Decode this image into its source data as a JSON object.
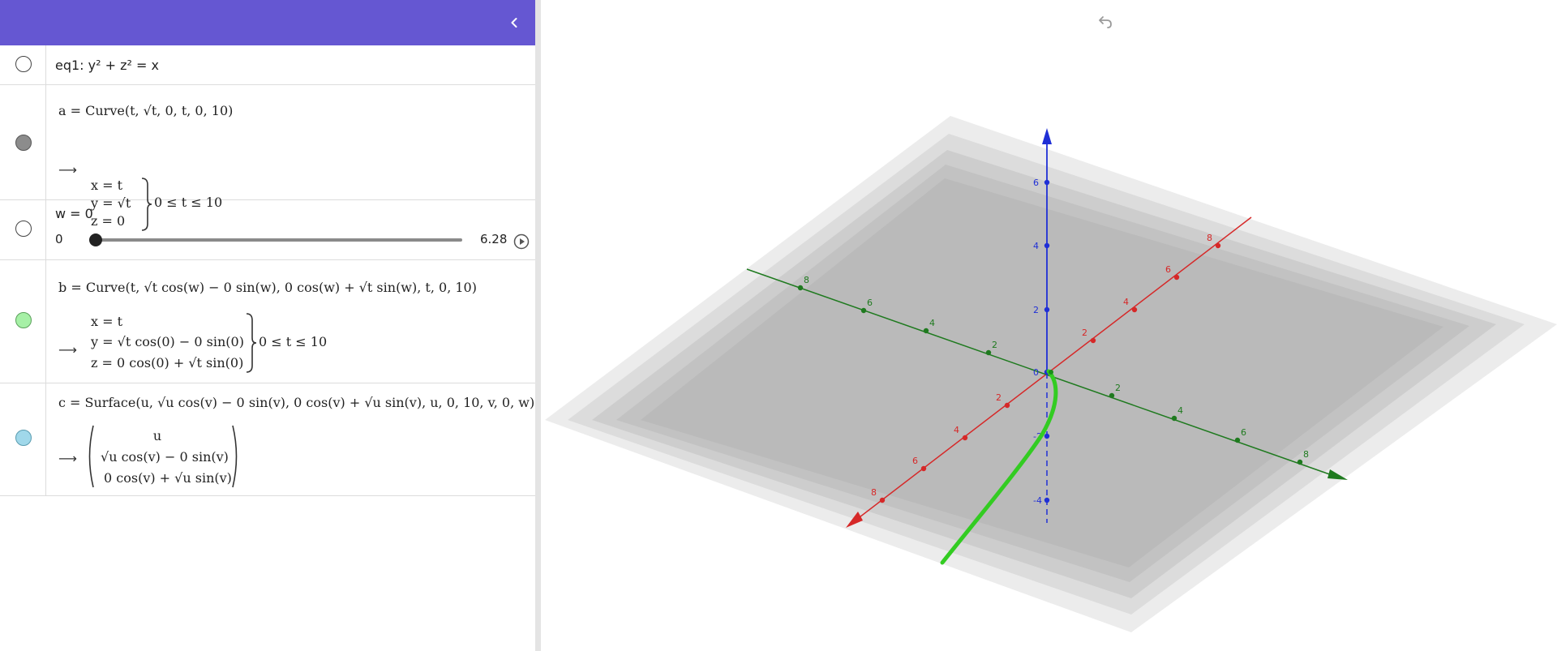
{
  "header": {
    "color": "#6557d2",
    "collapse_icon": "chevron-left-icon"
  },
  "toolbar": {
    "undo_icon": "undo-icon"
  },
  "algebra": {
    "eq1": {
      "label": "eq1: y² + z² = x",
      "visible": false
    },
    "a": {
      "definition": "a = Curve(t, √t, 0, t, 0, 10)",
      "result": {
        "x": "x = t",
        "y": "y = √t",
        "z": "z = 0",
        "range": "0 ≤ t ≤ 10"
      },
      "marble_color": "#8c8c8c",
      "visible": true
    },
    "w": {
      "label": "w = 0",
      "min": "0",
      "max": "6.28",
      "value": 0,
      "play_icon": "play-icon",
      "visible": false
    },
    "b": {
      "definition": "b = Curve(t, √t cos(w) − 0 sin(w), 0 cos(w) + √t sin(w), t, 0, 10)",
      "result": {
        "x": "x = t",
        "y": "y = √t cos(0) − 0 sin(0)",
        "z": "z = 0 cos(0) + √t sin(0)",
        "range": "0 ≤ t ≤ 10"
      },
      "marble_color": "#a6f0a6",
      "visible": true
    },
    "c": {
      "definition": "c = Surface(u, √u cos(v) − 0 sin(v), 0 cos(v) + √u sin(v), u, 0, 10, v, 0, w)",
      "result": {
        "r1": "u",
        "r2": "√u cos(v) − 0 sin(v)",
        "r3": "0 cos(v) + √u sin(v)"
      },
      "marble_color": "#a0d8ea",
      "visible": true
    },
    "result_arrow": "⟶"
  },
  "graphics3d": {
    "colors": {
      "x_axis": "#d62828",
      "y_axis": "#1f7a1f",
      "z_axis": "#1f2fd6",
      "curve": "#33cc22",
      "plane": "#b8b8b8"
    },
    "x_axis_ticks": [
      "8",
      "6",
      "4",
      "2",
      "2",
      "4",
      "6",
      "8"
    ],
    "y_axis_ticks": [
      "8",
      "6",
      "4",
      "2",
      "2",
      "4",
      "6",
      "8"
    ],
    "z_axis_ticks": [
      "6",
      "4",
      "2",
      "0",
      "-2",
      "-4"
    ]
  }
}
